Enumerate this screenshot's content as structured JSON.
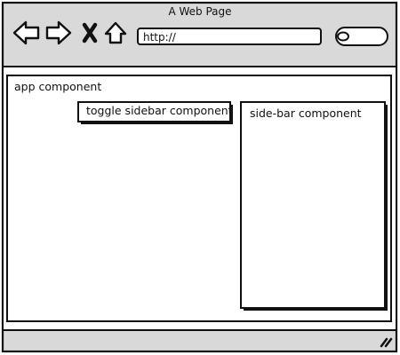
{
  "browser": {
    "title": "A Web Page",
    "address": "http://",
    "icons": [
      "back-arrow-icon",
      "forward-arrow-icon",
      "close-x-icon",
      "home-icon",
      "search-icon",
      "resize-grip-icon"
    ]
  },
  "app_component": {
    "label": "app component"
  },
  "toggle_button": {
    "label": "toggle sidebar component"
  },
  "sidebar_component": {
    "label": "side-bar component"
  },
  "colors": {
    "chrome": "#d9d9d9",
    "line": "#111111",
    "content": "#ffffff"
  }
}
